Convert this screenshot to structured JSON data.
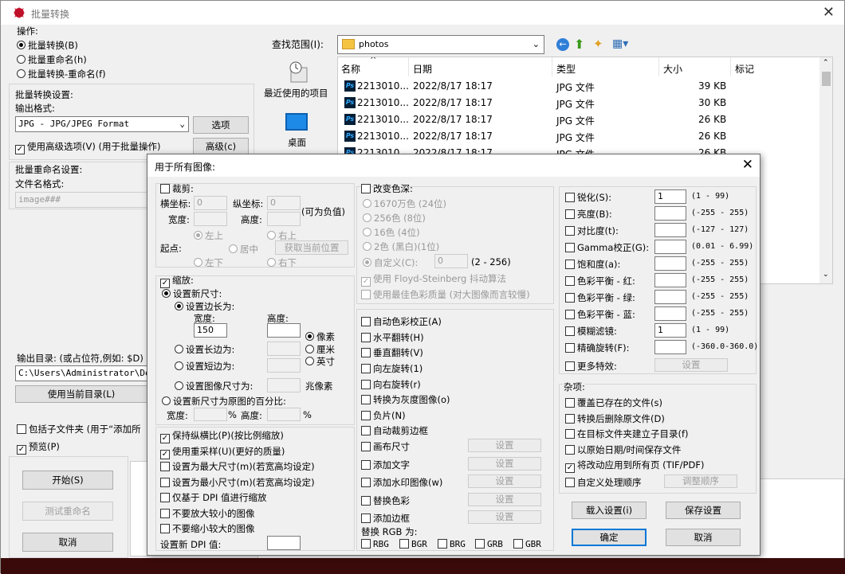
{
  "window": {
    "title": "批量转换"
  },
  "ops": {
    "heading": "操作:",
    "opt1": "批量转换(B)",
    "opt2": "批量重命名(h)",
    "opt3": "批量转换-重命名(f)"
  },
  "convert": {
    "heading": "批量转换设置:",
    "format_label": "输出格式:",
    "format_value": "JPG - JPG/JPEG Format",
    "options_btn": "选项",
    "advanced_cb": "使用高级选项(V) (用于批量操作)",
    "advanced_btn": "高级(c)"
  },
  "rename": {
    "heading": "批量重命名设置:",
    "filename_label": "文件名格式:",
    "filename_value": "image###"
  },
  "output": {
    "label": "输出目录: (或占位符,例如: $D)",
    "path": "C:\\Users\\Administrator\\Desk",
    "use_current_btn": "使用当前目录(L)",
    "subfolders_cb": "包括子文件夹 (用于“添加所",
    "preview_cb": "预览(P)"
  },
  "actions": {
    "start": "开始(S)",
    "test_rename": "测试重命名",
    "cancel": "取消"
  },
  "browser": {
    "lookin_label": "查找范围(I):",
    "folder": "photos",
    "recent": "最近使用的项目",
    "desktop": "桌面",
    "columns": [
      "名称",
      "日期",
      "类型",
      "大小",
      "标记"
    ],
    "files": [
      {
        "name": "2213010...",
        "date": "2022/8/17 18:17",
        "type": "JPG 文件",
        "size": "39 KB"
      },
      {
        "name": "2213010...",
        "date": "2022/8/17 18:17",
        "type": "JPG 文件",
        "size": "30 KB"
      },
      {
        "name": "2213010...",
        "date": "2022/8/17 18:17",
        "type": "JPG 文件",
        "size": "26 KB"
      },
      {
        "name": "2213010...",
        "date": "2022/8/17 18:17",
        "type": "JPG 文件",
        "size": "26 KB"
      },
      {
        "name": "2213010...",
        "date": "2022/8/17 18:17",
        "type": "JPG 文件",
        "size": "26 KB"
      }
    ]
  },
  "dialog": {
    "title": "用于所有图像:",
    "crop": {
      "cb": "裁剪:",
      "x_label": "横坐标:",
      "x_val": "0",
      "y_label": "纵坐标:",
      "y_val": "0",
      "neg_note": "(可为负值)",
      "w_label": "宽度:",
      "h_label": "高度:",
      "origin_label": "起点:",
      "tl": "左上",
      "tr": "右上",
      "center": "居中",
      "get_pos_btn": "获取当前位置",
      "bl": "左下",
      "br": "右下"
    },
    "resize": {
      "cb": "缩放:",
      "set_new": "设置新尺寸:",
      "set_sides": "设置边长为:",
      "w_label": "宽度:",
      "w_val": "150",
      "h_label": "高度:",
      "unit_px": "像素",
      "unit_cm": "厘米",
      "unit_in": "英寸",
      "long_side": "设置长边为:",
      "short_side": "设置短边为:",
      "megapixels": "设置图像尺寸为:",
      "mp_unit": "兆像素",
      "percent": "设置新尺寸为原图的百分比:",
      "pct_w": "宽度:",
      "pct_h": "高度:",
      "pct_sign": "%"
    },
    "left_opts": [
      "保持纵横比(P)(按比例缩放)",
      "使用重采样(U)(更好的质量)",
      "设置为最大尺寸(m)(若宽高均设定)",
      "设置为最小尺寸(m)(若宽高均设定)",
      "仅基于 DPI 值进行缩放",
      "不要放大较小的图像",
      "不要缩小较大的图像"
    ],
    "new_dpi": "设置新 DPI 值:",
    "depth": {
      "cb": "改变色深:",
      "o1": "1670万色 (24位)",
      "o2": "256色 (8位)",
      "o3": "16色 (4位)",
      "o4": "2色 (黑白)(1位)",
      "o5": "自定义(C):",
      "o5_val": "0",
      "o5_range": "(2 - 256)",
      "fs": "使用 Floyd-Steinberg 抖动算法",
      "best": "使用最佳色彩质量 (对大图像而言较慢)"
    },
    "mid_opts": [
      "自动色彩校正(A)",
      "水平翻转(H)",
      "垂直翻转(V)",
      "向左旋转(1)",
      "向右旋转(r)",
      "转换为灰度图像(o)",
      "负片(N)",
      "自动裁剪边框",
      "画布尺寸",
      "添加文字",
      "添加水印图像(w)",
      "替换色彩",
      "添加边框"
    ],
    "settings_btn": "设置",
    "swap_label": "替换 RGB 为:",
    "swap": [
      "RBG",
      "BGR",
      "BRG",
      "GRB",
      "GBR"
    ],
    "adjust": [
      {
        "label": "锐化(S):",
        "val": "1",
        "range": "(1 - 99)"
      },
      {
        "label": "亮度(B):",
        "val": "",
        "range": "(-255 - 255)"
      },
      {
        "label": "对比度(t):",
        "val": "",
        "range": "(-127 - 127)"
      },
      {
        "label": "Gamma校正(G):",
        "val": "",
        "range": "(0.01 - 6.99)"
      },
      {
        "label": "饱和度(a):",
        "val": "",
        "range": "(-255 - 255)"
      },
      {
        "label": "色彩平衡 - 红:",
        "val": "",
        "range": "(-255 - 255)"
      },
      {
        "label": "色彩平衡 - 绿:",
        "val": "",
        "range": "(-255 - 255)"
      },
      {
        "label": "色彩平衡 - 蓝:",
        "val": "",
        "range": "(-255 - 255)"
      },
      {
        "label": "模糊滤镜:",
        "val": "1",
        "range": "(1 - 99)"
      },
      {
        "label": "精确旋转(F):",
        "val": "",
        "range": "(-360.0-360.0)"
      }
    ],
    "more_fx": "更多特效:",
    "more_fx_btn": "设置",
    "misc": {
      "heading": "杂项:",
      "opts": [
        "覆盖已存在的文件(s)",
        "转换后删除原文件(D)",
        "在目标文件夹建立子目录(f)",
        "以原始日期/时间保存文件",
        "将改动应用到所有页 (TIF/PDF)",
        "自定义处理顺序"
      ],
      "order_btn": "调整顺序"
    },
    "load_btn": "载入设置(i)",
    "save_btn": "保存设置",
    "ok_btn": "确定",
    "cancel_btn": "取消"
  }
}
